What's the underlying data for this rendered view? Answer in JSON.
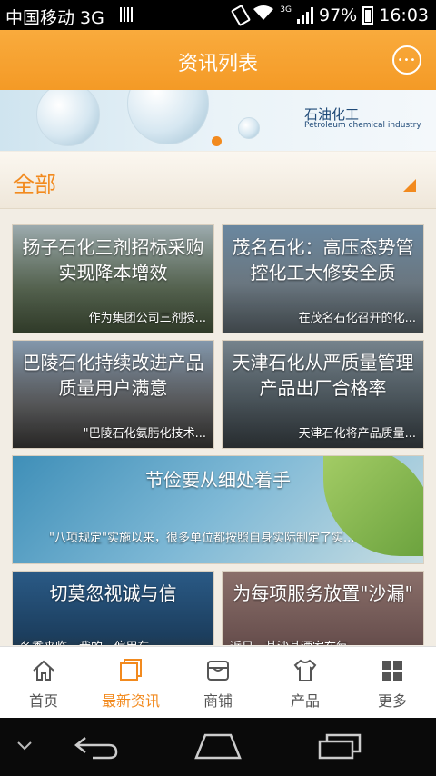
{
  "status_bar": {
    "carrier": "中国移动 3G",
    "network": "3G",
    "battery": "97%",
    "time": "16:03"
  },
  "header": {
    "title": "资讯列表",
    "chat_icon": "chat-bubble-icon"
  },
  "banner": {
    "brand": "石油化工",
    "brand_en": "Petroleum chemical industry"
  },
  "category": {
    "label": "全部",
    "dropdown_icon": "triangle-down-icon"
  },
  "news": [
    {
      "title": "扬子石化三剂招标采购实现降本增效",
      "subtitle": "作为集团公司三剂授..."
    },
    {
      "title": "茂名石化：高压态势管控化工大修安全质",
      "subtitle": "在茂名石化召开的化..."
    },
    {
      "title": "巴陵石化持续改进产品质量用户满意",
      "subtitle": "\"巴陵石化氨肟化技术..."
    },
    {
      "title": "天津石化从严质量管理　产品出厂合格率",
      "subtitle": "天津石化将产品质量..."
    },
    {
      "title": "节俭要从细处着手",
      "subtitle": "\"八项规定\"实施以来，很多单位都按照自身实际制定了实..."
    },
    {
      "title": "切莫忽视诚与信",
      "subtitle": "冬季来临，我的...偏用车..."
    },
    {
      "title": "为每项服务放置\"沙漏\"",
      "subtitle": "近日，某沙某酒家在每..."
    }
  ],
  "tabs": [
    {
      "label": "首页",
      "icon": "home-icon",
      "active": false
    },
    {
      "label": "最新资讯",
      "icon": "news-icon",
      "active": true
    },
    {
      "label": "商铺",
      "icon": "shop-icon",
      "active": false
    },
    {
      "label": "产品",
      "icon": "shirt-icon",
      "active": false
    },
    {
      "label": "更多",
      "icon": "grid-icon",
      "active": false
    }
  ],
  "colors": {
    "accent": "#f28a1e",
    "header": "#f7a233"
  }
}
